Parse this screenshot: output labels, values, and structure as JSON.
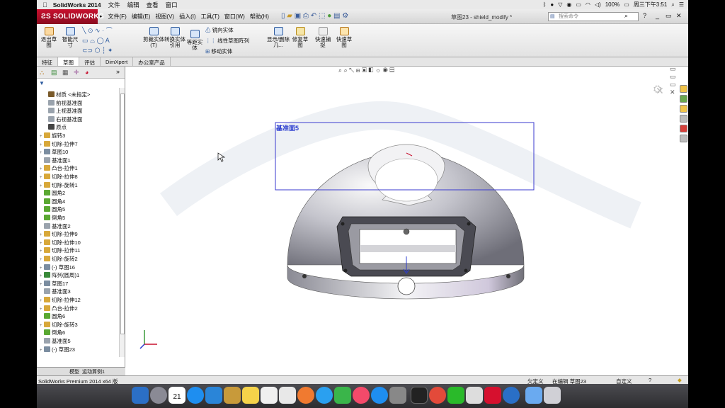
{
  "mac_menubar": {
    "app_name": "SolidWorks 2014",
    "menus": [
      "文件",
      "编辑",
      "查看",
      "窗口"
    ],
    "battery": "100%",
    "clock": "周三下午3:51"
  },
  "sw_titlebar": {
    "logo_text": "SOLIDWORKS",
    "menus": [
      "文件(F)",
      "编辑(E)",
      "视图(V)",
      "插入(I)",
      "工具(T)",
      "窗口(W)",
      "帮助(H)"
    ],
    "document_title": "草图23 - shield_modify *",
    "search_placeholder": "搜索命令"
  },
  "command_manager": {
    "exit_sketch": "退出草图",
    "smart_dimension": "智能尺寸",
    "trim": "剪裁实体(T)",
    "convert": "转换实体引用",
    "offset": "等距实体",
    "mirror": "镜向实体",
    "linear_pattern": "线性草图阵列",
    "move": "移动实体",
    "display_delete": "显示/删除几...",
    "repair": "修复草图",
    "rapid_sketch": "快速捕捉",
    "quick_sketch": "快速草图"
  },
  "tabs": [
    "特征",
    "草图",
    "评估",
    "DimXpert",
    "办公室产品"
  ],
  "active_tab": "草图",
  "feature_tree": [
    {
      "label": "材质 <未指定>",
      "icon": "material-icon",
      "color": "#7a5a2a"
    },
    {
      "label": "前视基准面",
      "icon": "plane-icon",
      "color": "#9aa3ad"
    },
    {
      "label": "上视基准面",
      "icon": "plane-icon",
      "color": "#9aa3ad"
    },
    {
      "label": "右视基准面",
      "icon": "plane-icon",
      "color": "#9aa3ad"
    },
    {
      "label": "原点",
      "icon": "origin-icon",
      "color": "#444444"
    },
    {
      "label": "旋转3",
      "icon": "revolve-icon",
      "color": "#d8a83a"
    },
    {
      "label": "切除-拉伸7",
      "icon": "cut-extrude-icon",
      "color": "#d8a83a"
    },
    {
      "label": "草图10",
      "icon": "sketch-icon",
      "color": "#7b8da0"
    },
    {
      "label": "基准面1",
      "icon": "plane-icon",
      "color": "#9aa3ad"
    },
    {
      "label": "凸台-拉伸1",
      "icon": "boss-extrude-icon",
      "color": "#d8a83a"
    },
    {
      "label": "切除-拉伸8",
      "icon": "cut-extrude-icon",
      "color": "#d8a83a"
    },
    {
      "label": "切除-旋转1",
      "icon": "cut-revolve-icon",
      "color": "#d8a83a"
    },
    {
      "label": "圆角2",
      "icon": "fillet-icon",
      "color": "#5aa832"
    },
    {
      "label": "圆角4",
      "icon": "fillet-icon",
      "color": "#5aa832"
    },
    {
      "label": "圆角5",
      "icon": "fillet-icon",
      "color": "#5aa832"
    },
    {
      "label": "倒角5",
      "icon": "chamfer-icon",
      "color": "#5aa832"
    },
    {
      "label": "基准面2",
      "icon": "plane-icon",
      "color": "#9aa3ad"
    },
    {
      "label": "切除-拉伸9",
      "icon": "cut-extrude-icon",
      "color": "#d8a83a"
    },
    {
      "label": "切除-拉伸10",
      "icon": "cut-extrude-icon",
      "color": "#d8a83a"
    },
    {
      "label": "切除-拉伸11",
      "icon": "cut-extrude-icon",
      "color": "#d8a83a"
    },
    {
      "label": "切除-旋转2",
      "icon": "cut-revolve-icon",
      "color": "#d8a83a"
    },
    {
      "label": "(-) 草图16",
      "icon": "sketch-icon",
      "color": "#7b8da0"
    },
    {
      "label": "阵列(圆周)1",
      "icon": "pattern-icon",
      "color": "#3a8a3a"
    },
    {
      "label": "草图17",
      "icon": "sketch-icon",
      "color": "#7b8da0"
    },
    {
      "label": "基准面3",
      "icon": "plane-icon",
      "color": "#9aa3ad"
    },
    {
      "label": "切除-拉伸12",
      "icon": "cut-extrude-icon",
      "color": "#d8a83a"
    },
    {
      "label": "凸台-拉伸2",
      "icon": "boss-extrude-icon",
      "color": "#d8a83a"
    },
    {
      "label": "圆角6",
      "icon": "fillet-icon",
      "color": "#5aa832"
    },
    {
      "label": "切除-旋转3",
      "icon": "cut-revolve-icon",
      "color": "#d8a83a"
    },
    {
      "label": "倒角6",
      "icon": "chamfer-icon",
      "color": "#5aa832"
    },
    {
      "label": "基准面5",
      "icon": "plane-icon",
      "color": "#9aa3ad"
    },
    {
      "label": "(-) 草图23",
      "icon": "sketch-icon",
      "color": "#7b8da0"
    }
  ],
  "bottom_tabs": [
    "模型",
    "运动算例1"
  ],
  "viewport": {
    "plane_label": "基准面5"
  },
  "status_bar": {
    "left": "SolidWorks Premium 2014 x64 版",
    "state": "欠定义",
    "editing": "在编辑 草图23",
    "units": "自定义"
  },
  "dock": {
    "calendar_day": "21"
  }
}
